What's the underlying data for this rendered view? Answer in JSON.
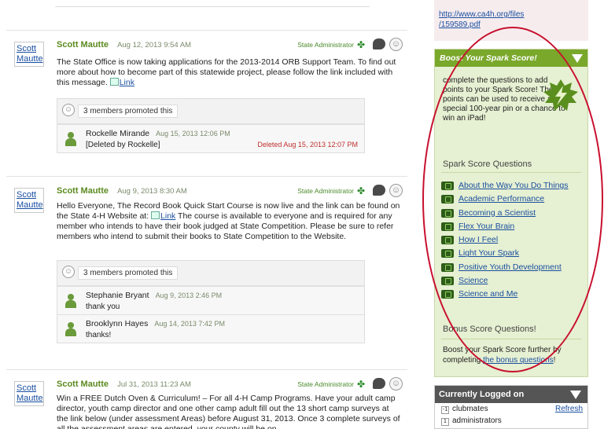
{
  "feed": {
    "posts": [
      {
        "avatar_label": "Scott Mautte",
        "author": "Scott Mautte",
        "time": "Aug 12, 2013 9:54 AM",
        "role": "State Administrator",
        "body": "The State Office is now taking applications for the 2013-2014 ORB Support Team. To find out more about how to become part of this statewide project, please follow the link included with this message.",
        "link_label": "Link",
        "promoted": "3 members promoted this",
        "replies": [
          {
            "name": "Rockelle Mirande",
            "time": "Aug 15, 2013 12:06 PM",
            "text": "[Deleted by Rockelle]",
            "deleted": "Deleted Aug 15, 2013 12:07 PM"
          }
        ]
      },
      {
        "avatar_label": "Scott Mautte",
        "author": "Scott Mautte",
        "time": "Aug 9, 2013 8:30 AM",
        "role": "State Administrator",
        "body_before": "Hello Everyone, The Record Book Quick Start Course is now live and the link can be found on the State 4-H Website at:",
        "link_label": "Link",
        "body_after": "The course is available to everyone and is required for any member who intends to have their book judged at State Competition. Please be sure to refer members who intend to submit their books to State Competition to the Website.",
        "promoted": "3 members promoted this",
        "replies": [
          {
            "name": "Stephanie Bryant",
            "time": "Aug 9, 2013 2:46 PM",
            "text": "thank you"
          },
          {
            "name": "Brooklynn Hayes",
            "time": "Aug 14, 2013 7:42 PM",
            "text": "thanks!"
          }
        ]
      },
      {
        "avatar_label": "Scott Mautte",
        "author": "Scott Mautte",
        "time": "Jul 31, 2013 11:23 AM",
        "role": "State Administrator",
        "body": "Win a FREE Dutch Oven & Curriculum! – For all 4-H Camp Programs. Have your adult camp director, youth camp director and one other camp adult fill out the 13 short camp surveys at the link below (under assessment Areas) before August 31, 2013. Once 3 complete surveys of all the assessment areas are entered, your county will be on"
      }
    ]
  },
  "sidebar": {
    "top_link": "http://www.ca4h.org/files/159589.pdf",
    "top_link_line1": "http://www.ca4h.org/files",
    "top_link_line2": "/159589.pdf",
    "spark": {
      "title": "Boost Your Spark Score!",
      "intro": "complete the questions to add points to your Spark Score! These points can be used to receive a special 100-year pin or a chance to win an iPad!",
      "questions_heading": "Spark Score Questions",
      "questions": [
        "About the Way You Do Things",
        "Academic Performance",
        "Becoming a Scientist",
        "Flex Your Brain",
        "How I Feel",
        "Light Your Spark",
        "Positive Youth Development",
        "Science",
        "Science and Me"
      ],
      "bonus_heading": "Bonus Score Questions!",
      "bonus_text": "Boost your Spark Score further by completing",
      "bonus_link": "the bonus questions",
      "bonus_end": "!"
    },
    "logged": {
      "title": "Currently Logged on",
      "refresh": "Refresh",
      "rows": [
        {
          "count": "-1",
          "label": "clubmates"
        },
        {
          "count": "1",
          "label": "administrators"
        }
      ]
    }
  },
  "colors": {
    "accent_green": "#7aa82b",
    "link_blue": "#1a4fa0",
    "annotation_red": "#c8102e",
    "deleted_red": "#c03030"
  }
}
